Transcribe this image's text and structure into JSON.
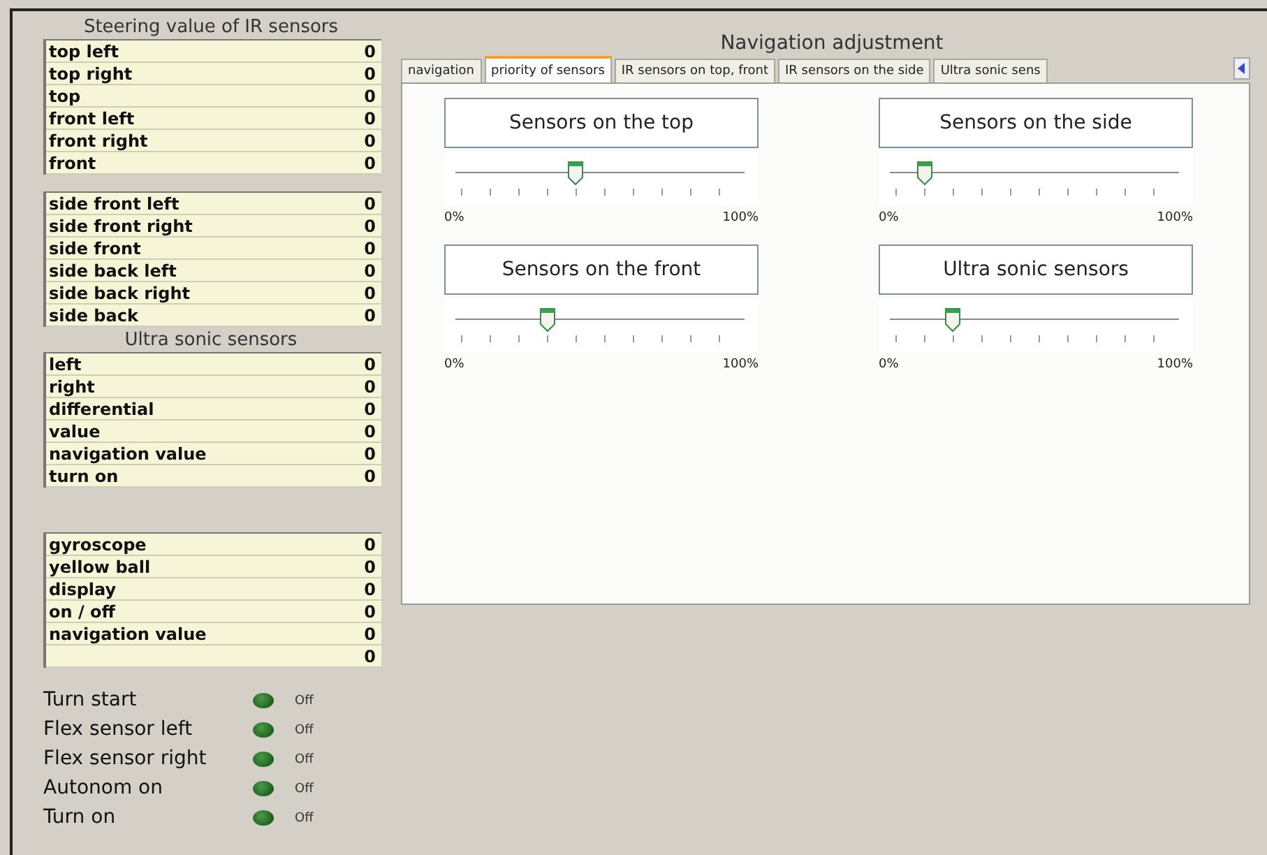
{
  "ir_panel": {
    "title": "Steering value of IR sensors",
    "top_table": [
      {
        "label": "top left",
        "value": "0"
      },
      {
        "label": "top right",
        "value": "0"
      },
      {
        "label": "top",
        "value": "0"
      },
      {
        "label": "front left",
        "value": "0"
      },
      {
        "label": "front right",
        "value": "0"
      },
      {
        "label": "front",
        "value": "0"
      }
    ],
    "side_table": [
      {
        "label": "side front left",
        "value": "0"
      },
      {
        "label": "side front right",
        "value": "0"
      },
      {
        "label": "side front",
        "value": "0"
      },
      {
        "label": "side back left",
        "value": "0"
      },
      {
        "label": "side back right",
        "value": "0"
      },
      {
        "label": "side back",
        "value": "0"
      }
    ]
  },
  "ultrasonic_panel": {
    "title": "Ultra sonic sensors",
    "table": [
      {
        "label": "left",
        "value": "0"
      },
      {
        "label": "right",
        "value": "0"
      },
      {
        "label": "differential",
        "value": "0"
      },
      {
        "label": "value",
        "value": "0"
      },
      {
        "label": "navigation value",
        "value": "0"
      },
      {
        "label": "turn on",
        "value": "0"
      }
    ]
  },
  "misc_table": [
    {
      "label": "gyroscope",
      "value": "0"
    },
    {
      "label": "yellow ball",
      "value": "0"
    },
    {
      "label": "display",
      "value": "0"
    },
    {
      "label": "on / off",
      "value": "0"
    },
    {
      "label": "navigation value",
      "value": "0"
    },
    {
      "value": "0"
    }
  ],
  "indicators": [
    {
      "label": "Turn start",
      "on": false,
      "state": "Off"
    },
    {
      "label": "Flex sensor left",
      "on": false,
      "state": "Off"
    },
    {
      "label": "Flex sensor right",
      "on": false,
      "state": "Off"
    },
    {
      "label": "Autonom on",
      "on": false,
      "state": "Off"
    },
    {
      "label": "Turn on",
      "on": false,
      "state": "Off"
    }
  ],
  "navigation": {
    "title": "Navigation adjustment",
    "tabs": [
      {
        "label": "navigation",
        "selected": false
      },
      {
        "label": "priority of sensors",
        "selected": true
      },
      {
        "label": "IR sensors on top, front",
        "selected": false
      },
      {
        "label": "IR sensors on the side",
        "selected": false
      },
      {
        "label": "Ultra sonic sens",
        "selected": false
      }
    ],
    "sliders": [
      {
        "label": "Sensors on the top",
        "level": 0.4,
        "min": "0%",
        "max": "100%"
      },
      {
        "label": "Sensors on the side",
        "level": 0.1,
        "min": "0%",
        "max": "100%"
      },
      {
        "label": "Sensors on the front",
        "level": 0.3,
        "min": "0%",
        "max": "100%"
      },
      {
        "label": "Ultra sonic sensors",
        "level": 0.2,
        "min": "0%",
        "max": "100%"
      }
    ]
  }
}
